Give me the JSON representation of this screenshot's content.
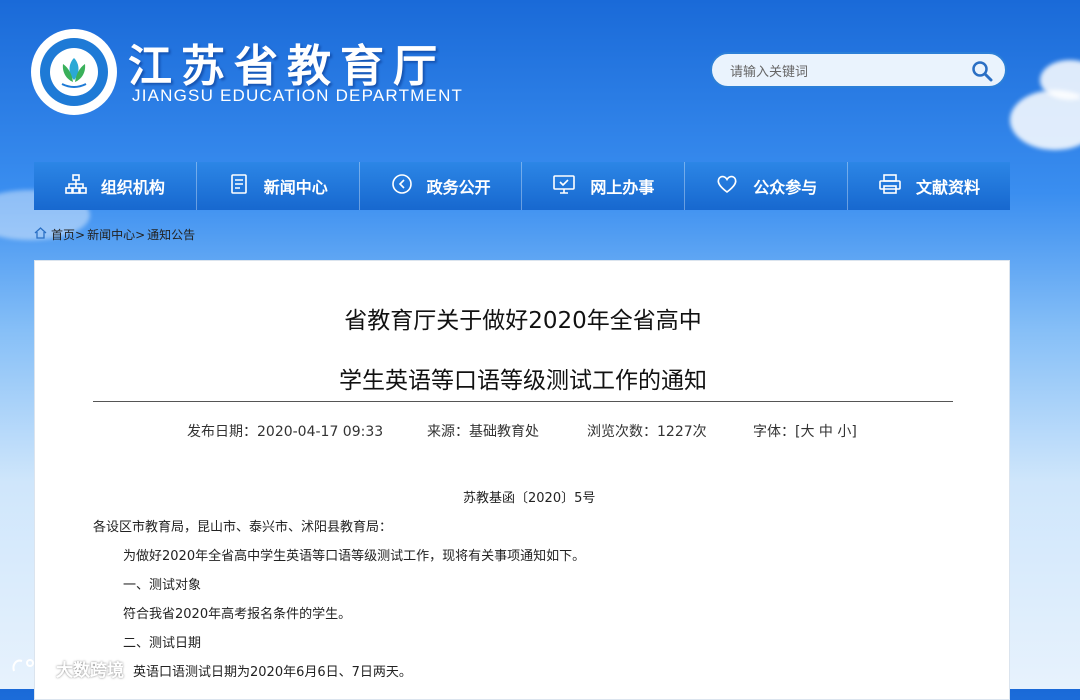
{
  "header": {
    "title": "江苏省教育厅",
    "subtitle": "JIANGSU EDUCATION DEPARTMENT"
  },
  "search": {
    "placeholder": "请输入关键词",
    "icon": "search-icon"
  },
  "nav": {
    "items": [
      {
        "label": "组织机构",
        "icon": "org-chart-icon"
      },
      {
        "label": "新闻中心",
        "icon": "document-icon"
      },
      {
        "label": "政务公开",
        "icon": "play-circle-icon"
      },
      {
        "label": "网上办事",
        "icon": "monitor-icon"
      },
      {
        "label": "公众参与",
        "icon": "heart-icon"
      },
      {
        "label": "文献资料",
        "icon": "printer-icon"
      }
    ]
  },
  "breadcrumb": {
    "home": "首页>",
    "news": "新闻中心>",
    "current": "通知公告"
  },
  "article": {
    "title_line1": "省教育厅关于做好2020年全省高中",
    "title_line2": "学生英语等口语等级测试工作的通知",
    "publish": "发布日期：2020-04-17 09:33",
    "source": "来源：基础教育处",
    "views": "浏览次数：1227次",
    "font": "字体：[大 中 小]",
    "doc_number": "苏教基函〔2020〕5号",
    "salutation": "各设区市教育局，昆山市、泰兴市、沭阳县教育局：",
    "intro": "为做好2020年全省高中学生英语等口语等级测试工作，现将有关事项通知如下。",
    "section1": "一、测试对象",
    "section1_text": "符合我省2020年高考报名条件的学生。",
    "section2": "二、测试日期",
    "section2_text": "英语口语测试日期为2020年6月6日、7日两天。"
  },
  "watermark": "大数跨境",
  "colors": {
    "nav": "#1c6fd4",
    "search_border": "#2c7fd8",
    "logo": "#1e7ad6"
  }
}
